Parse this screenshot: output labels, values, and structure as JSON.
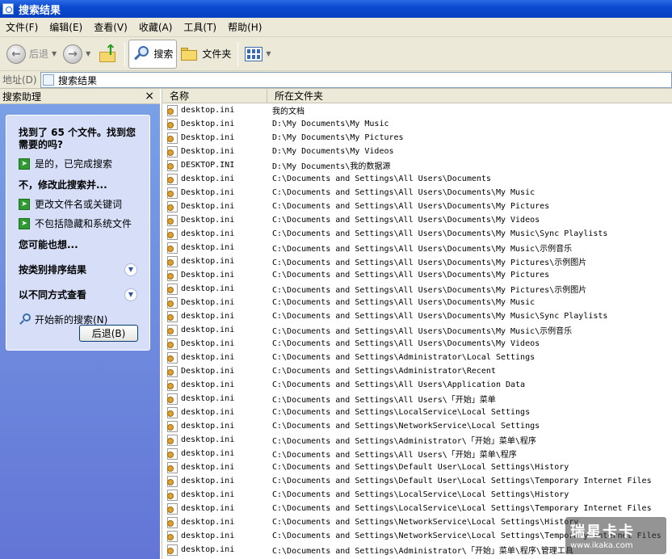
{
  "window": {
    "title": "搜索结果"
  },
  "menu": [
    "文件(F)",
    "编辑(E)",
    "查看(V)",
    "收藏(A)",
    "工具(T)",
    "帮助(H)"
  ],
  "toolbar": {
    "back_label": "后退",
    "search_label": "搜索",
    "folders_label": "文件夹"
  },
  "address": {
    "label": "地址(D)",
    "value": "搜索结果"
  },
  "assistant": {
    "pane_title": "搜索助理",
    "close": "×",
    "found_text": "找到了 65 个文件。找到您需要的吗?",
    "yes_done": "是的，已完成搜索",
    "no_heading": "不，修改此搜索并...",
    "change_name": "更改文件名或关键词",
    "exclude_hidden": "不包括隐藏和系统文件",
    "also_want": "您可能也想...",
    "sort_by_category": "按类别排序结果",
    "view_differently": "以不同方式查看",
    "new_search": "开始新的搜索(N)",
    "back_button": "后退(B)"
  },
  "list": {
    "columns": [
      "名称",
      "所在文件夹"
    ],
    "rows": [
      [
        "desktop.ini",
        "我的文档"
      ],
      [
        "Desktop.ini",
        "D:\\My Documents\\My Music"
      ],
      [
        "Desktop.ini",
        "D:\\My Documents\\My Pictures"
      ],
      [
        "Desktop.ini",
        "D:\\My Documents\\My Videos"
      ],
      [
        "DESKTOP.INI",
        "D:\\My Documents\\我的数据源"
      ],
      [
        "desktop.ini",
        "C:\\Documents and Settings\\All Users\\Documents"
      ],
      [
        "Desktop.ini",
        "C:\\Documents and Settings\\All Users\\Documents\\My Music"
      ],
      [
        "Desktop.ini",
        "C:\\Documents and Settings\\All Users\\Documents\\My Pictures"
      ],
      [
        "Desktop.ini",
        "C:\\Documents and Settings\\All Users\\Documents\\My Videos"
      ],
      [
        "desktop.ini",
        "C:\\Documents and Settings\\All Users\\Documents\\My Music\\Sync Playlists"
      ],
      [
        "desktop.ini",
        "C:\\Documents and Settings\\All Users\\Documents\\My Music\\示例音乐"
      ],
      [
        "desktop.ini",
        "C:\\Documents and Settings\\All Users\\Documents\\My Pictures\\示例图片"
      ],
      [
        "Desktop.ini",
        "C:\\Documents and Settings\\All Users\\Documents\\My Pictures"
      ],
      [
        "desktop.ini",
        "C:\\Documents and Settings\\All Users\\Documents\\My Pictures\\示例图片"
      ],
      [
        "Desktop.ini",
        "C:\\Documents and Settings\\All Users\\Documents\\My Music"
      ],
      [
        "desktop.ini",
        "C:\\Documents and Settings\\All Users\\Documents\\My Music\\Sync Playlists"
      ],
      [
        "desktop.ini",
        "C:\\Documents and Settings\\All Users\\Documents\\My Music\\示例音乐"
      ],
      [
        "Desktop.ini",
        "C:\\Documents and Settings\\All Users\\Documents\\My Videos"
      ],
      [
        "desktop.ini",
        "C:\\Documents and Settings\\Administrator\\Local Settings"
      ],
      [
        "Desktop.ini",
        "C:\\Documents and Settings\\Administrator\\Recent"
      ],
      [
        "desktop.ini",
        "C:\\Documents and Settings\\All Users\\Application Data"
      ],
      [
        "desktop.ini",
        "C:\\Documents and Settings\\All Users\\「开始」菜单"
      ],
      [
        "desktop.ini",
        "C:\\Documents and Settings\\LocalService\\Local Settings"
      ],
      [
        "desktop.ini",
        "C:\\Documents and Settings\\NetworkService\\Local Settings"
      ],
      [
        "desktop.ini",
        "C:\\Documents and Settings\\Administrator\\「开始」菜单\\程序"
      ],
      [
        "desktop.ini",
        "C:\\Documents and Settings\\All Users\\「开始」菜单\\程序"
      ],
      [
        "desktop.ini",
        "C:\\Documents and Settings\\Default User\\Local Settings\\History"
      ],
      [
        "desktop.ini",
        "C:\\Documents and Settings\\Default User\\Local Settings\\Temporary Internet Files"
      ],
      [
        "desktop.ini",
        "C:\\Documents and Settings\\LocalService\\Local Settings\\History"
      ],
      [
        "desktop.ini",
        "C:\\Documents and Settings\\LocalService\\Local Settings\\Temporary Internet Files"
      ],
      [
        "desktop.ini",
        "C:\\Documents and Settings\\NetworkService\\Local Settings\\History"
      ],
      [
        "desktop.ini",
        "C:\\Documents and Settings\\NetworkService\\Local Settings\\Temporary Internet Files"
      ],
      [
        "desktop.ini",
        "C:\\Documents and Settings\\Administrator\\「开始」菜单\\程序\\管理工具"
      ]
    ]
  },
  "watermark": {
    "big": "瑞星卡卡",
    "small": "www.ikaka.com"
  }
}
